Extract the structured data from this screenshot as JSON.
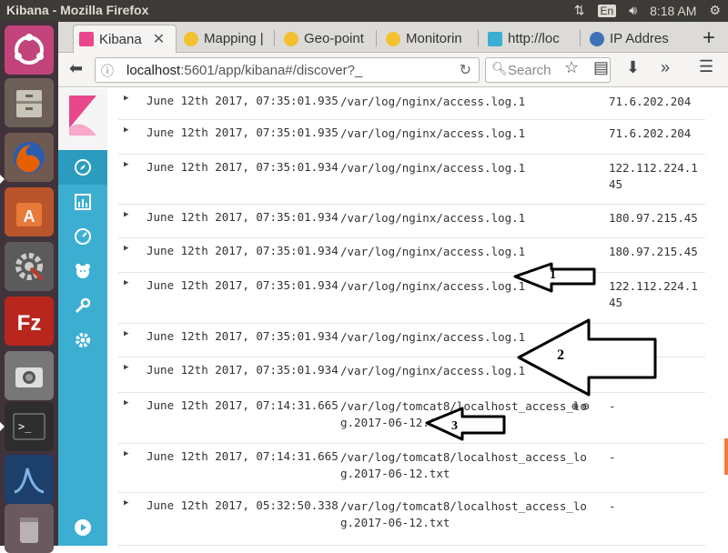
{
  "system_bar": {
    "window_title": "Kibana - Mozilla Firefox",
    "keyboard_layout": "En",
    "time": "8:18 AM"
  },
  "browser": {
    "tabs": [
      {
        "label": "Kibana",
        "favicon": "kibana-icon",
        "active": true
      },
      {
        "label": "Mapping |",
        "favicon": "elastic-icon"
      },
      {
        "label": "Geo-point",
        "favicon": "elastic-icon"
      },
      {
        "label": "Monitorin",
        "favicon": "elastic-icon"
      },
      {
        "label": "http://loc",
        "favicon": "page-icon"
      },
      {
        "label": "IP Addres",
        "favicon": "globe-icon"
      }
    ],
    "url_host": "localhost",
    "url_path": ":5601/app/kibana#/discover?_",
    "search_placeholder": "Search"
  },
  "documents": [
    {
      "timestamp": "June 12th 2017, 07:35:01.935",
      "source": "/var/log/nginx/access.log.1",
      "ip": "71.6.202.204"
    },
    {
      "timestamp": "June 12th 2017, 07:35:01.935",
      "source": "/var/log/nginx/access.log.1",
      "ip": "71.6.202.204"
    },
    {
      "timestamp": "June 12th 2017, 07:35:01.934",
      "source": "/var/log/nginx/access.log.1",
      "ip": "122.112.224.145"
    },
    {
      "timestamp": "June 12th 2017, 07:35:01.934",
      "source": "/var/log/nginx/access.log.1",
      "ip": "180.97.215.45"
    },
    {
      "timestamp": "June 12th 2017, 07:35:01.934",
      "source": "/var/log/nginx/access.log.1",
      "ip": "180.97.215.45"
    },
    {
      "timestamp": "June 12th 2017, 07:35:01.934",
      "source": "/var/log/nginx/access.log.1",
      "ip": "122.112.224.145"
    },
    {
      "timestamp": "June 12th 2017, 07:35:01.934",
      "source": "/var/log/nginx/access.log.1",
      "ip": ""
    },
    {
      "timestamp": "June 12th 2017, 07:35:01.934",
      "source": "/var/log/nginx/access.log.1",
      "ip": ""
    },
    {
      "timestamp": "June 12th 2017, 07:14:31.665",
      "source": "/var/log/tomcat8/localhost_access_log.2017-06-12.txt",
      "ip": "-"
    },
    {
      "timestamp": "June 12th 2017, 07:14:31.665",
      "source": "/var/log/tomcat8/localhost_access_log.2017-06-12.txt",
      "ip": "-"
    },
    {
      "timestamp": "June 12th 2017, 05:32:50.338",
      "source": "/var/log/tomcat8/localhost_access_log.2017-06-12.txt",
      "ip": "-"
    }
  ],
  "annotations": {
    "arrow_1": "1",
    "arrow_2": "2",
    "arrow_3": "3"
  }
}
